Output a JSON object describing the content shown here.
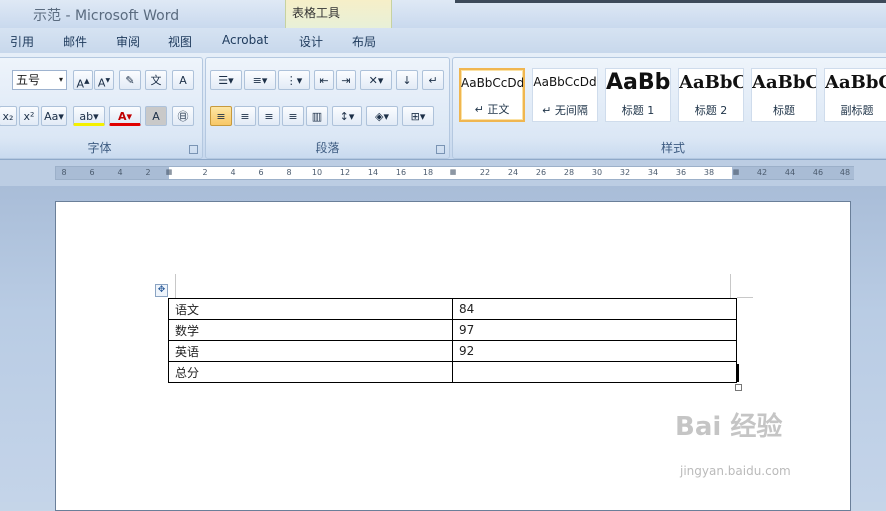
{
  "window": {
    "title": "示范 - Microsoft Word",
    "context_tab_group": "表格工具"
  },
  "tabs": [
    "引用",
    "邮件",
    "审阅",
    "视图",
    "Acrobat",
    "设计",
    "布局"
  ],
  "ribbon": {
    "font": {
      "size_value": "五号",
      "label": "字体"
    },
    "paragraph": {
      "label": "段落"
    },
    "styles": {
      "label": "样式",
      "items": [
        {
          "sample": "AaBbCcDd",
          "name": "↵ 正文",
          "active": true
        },
        {
          "sample": "AaBbCcDd",
          "name": "↵ 无间隔",
          "active": false
        },
        {
          "sample": "AaBb",
          "name": "标题 1",
          "active": false
        },
        {
          "sample": "AaBbC",
          "name": "标题 2",
          "active": false
        },
        {
          "sample": "AaBbC",
          "name": "标题",
          "active": false
        },
        {
          "sample": "AaBbC",
          "name": "副标题",
          "active": false
        }
      ]
    }
  },
  "ruler": {
    "ticks": [
      "8",
      "6",
      "4",
      "2",
      "2",
      "4",
      "6",
      "8",
      "10",
      "12",
      "14",
      "16",
      "18",
      "22",
      "24",
      "26",
      "28",
      "30",
      "32",
      "34",
      "36",
      "38",
      "42",
      "44",
      "46",
      "48"
    ]
  },
  "table": {
    "rows": [
      [
        "语文",
        "84"
      ],
      [
        "数学",
        "97"
      ],
      [
        "英语",
        "92"
      ],
      [
        "总分",
        ""
      ]
    ]
  },
  "watermark": {
    "brand": "Bai 经验",
    "url": "jingyan.baidu.com"
  }
}
